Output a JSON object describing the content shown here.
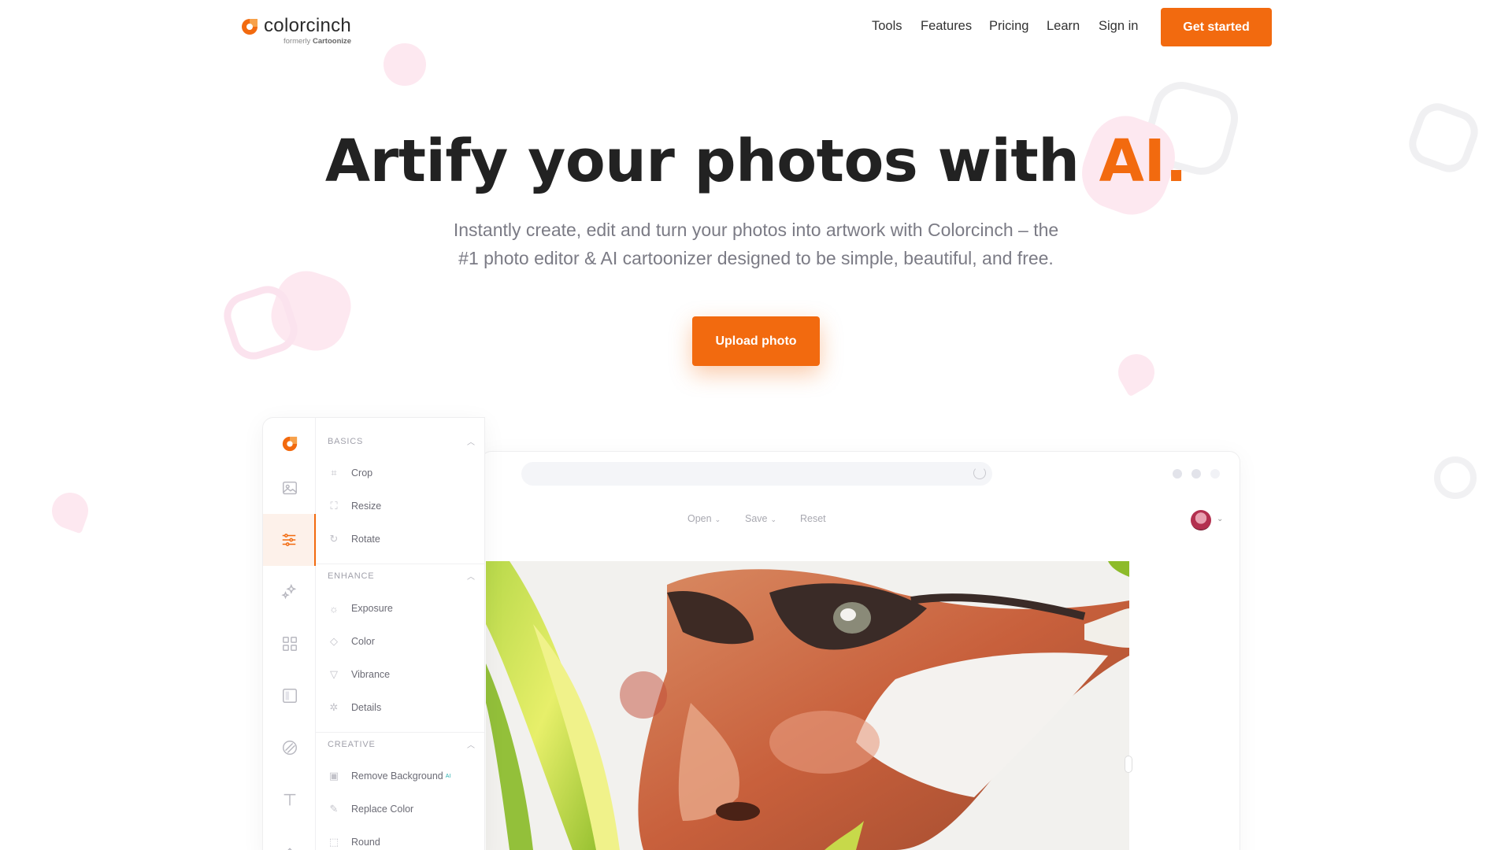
{
  "brand": {
    "name": "colorcinch",
    "formerly_prefix": "formerly",
    "formerly_name": "Cartoonize",
    "accent": "#f26a0f"
  },
  "nav": {
    "items": [
      "Tools",
      "Features",
      "Pricing",
      "Learn",
      "Sign in"
    ],
    "cta": "Get started"
  },
  "hero": {
    "title_main": "Artify your photos with ",
    "title_accent": "AI.",
    "subtitle_line1": "Instantly create, edit and turn your photos into artwork with Colorcinch – the",
    "subtitle_line2": "#1 photo editor & AI cartoonizer designed to be simple, beautiful, and free.",
    "upload_button": "Upload photo"
  },
  "editor": {
    "toolbar": [
      "Open",
      "Save",
      "Reset"
    ],
    "rail_icons": [
      "logo-icon",
      "image-icon",
      "adjust-icon",
      "effects-icon",
      "grid-icon",
      "frame-icon",
      "mask-icon",
      "text-icon",
      "more-icon"
    ],
    "sections": [
      {
        "title": "BASICS",
        "tools": [
          {
            "label": "Crop",
            "icon": "crop-icon",
            "badge": ""
          },
          {
            "label": "Resize",
            "icon": "resize-icon",
            "badge": ""
          },
          {
            "label": "Rotate",
            "icon": "rotate-icon",
            "badge": ""
          }
        ]
      },
      {
        "title": "ENHANCE",
        "tools": [
          {
            "label": "Exposure",
            "icon": "sun-icon",
            "badge": ""
          },
          {
            "label": "Color",
            "icon": "drop-icon",
            "badge": ""
          },
          {
            "label": "Vibrance",
            "icon": "shield-icon",
            "badge": ""
          },
          {
            "label": "Details",
            "icon": "gear-icon",
            "badge": ""
          }
        ]
      },
      {
        "title": "CREATIVE",
        "tools": [
          {
            "label": "Remove Background",
            "icon": "remove-bg-icon",
            "badge": "AI"
          },
          {
            "label": "Replace Color",
            "icon": "replace-color-icon",
            "badge": ""
          },
          {
            "label": "Round",
            "icon": "round-corner-icon",
            "badge": ""
          }
        ]
      }
    ]
  }
}
